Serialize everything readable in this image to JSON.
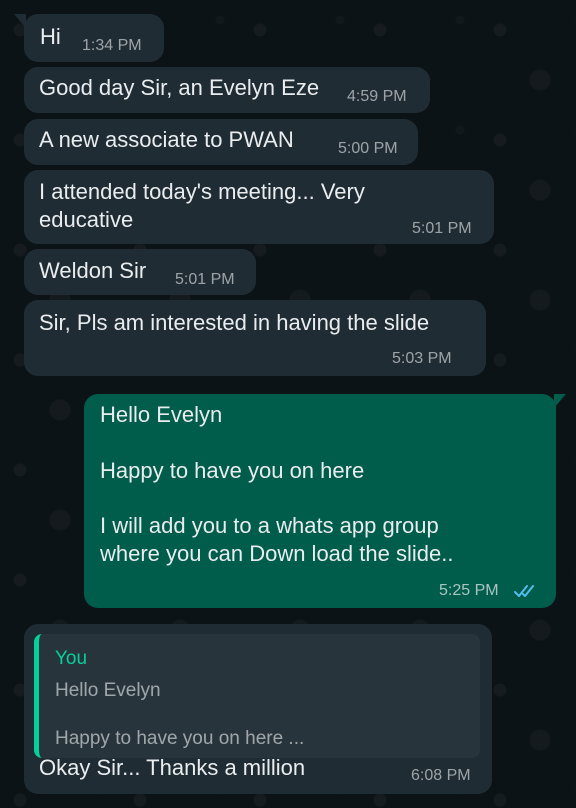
{
  "messages": [
    {
      "text": "Hi",
      "time": "1:34 PM",
      "direction": "incoming"
    },
    {
      "text": "Good day Sir, an Evelyn Eze",
      "time": "4:59 PM",
      "direction": "incoming"
    },
    {
      "text": "A new associate to PWAN",
      "time": "5:00 PM",
      "direction": "incoming"
    },
    {
      "lines": [
        "I attended today's meeting... Very",
        "educative"
      ],
      "time": "5:01 PM",
      "direction": "incoming"
    },
    {
      "text": "Weldon Sir",
      "time": "5:01 PM",
      "direction": "incoming"
    },
    {
      "text": "Sir, Pls am interested in having the slide",
      "time": "5:03 PM",
      "direction": "incoming"
    },
    {
      "lines": [
        "Hello Evelyn",
        "Happy to have you on here",
        "I will add you to a whats app group",
        "where you can Down load the slide.."
      ],
      "time": "5:25 PM",
      "direction": "outgoing",
      "status_icon": "double-check-read-icon"
    },
    {
      "quote": {
        "author": "You",
        "lines": [
          "Hello Evelyn",
          "Happy to have you on here ..."
        ]
      },
      "text": "Okay Sir... Thanks a million",
      "time": "6:08 PM",
      "direction": "incoming"
    }
  ],
  "colors": {
    "background": "#0c1317",
    "incoming_bubble": "#202c33",
    "outgoing_bubble": "#005c4b",
    "quote_accent": "#06cf9c",
    "read_ticks": "#53bdeb"
  }
}
